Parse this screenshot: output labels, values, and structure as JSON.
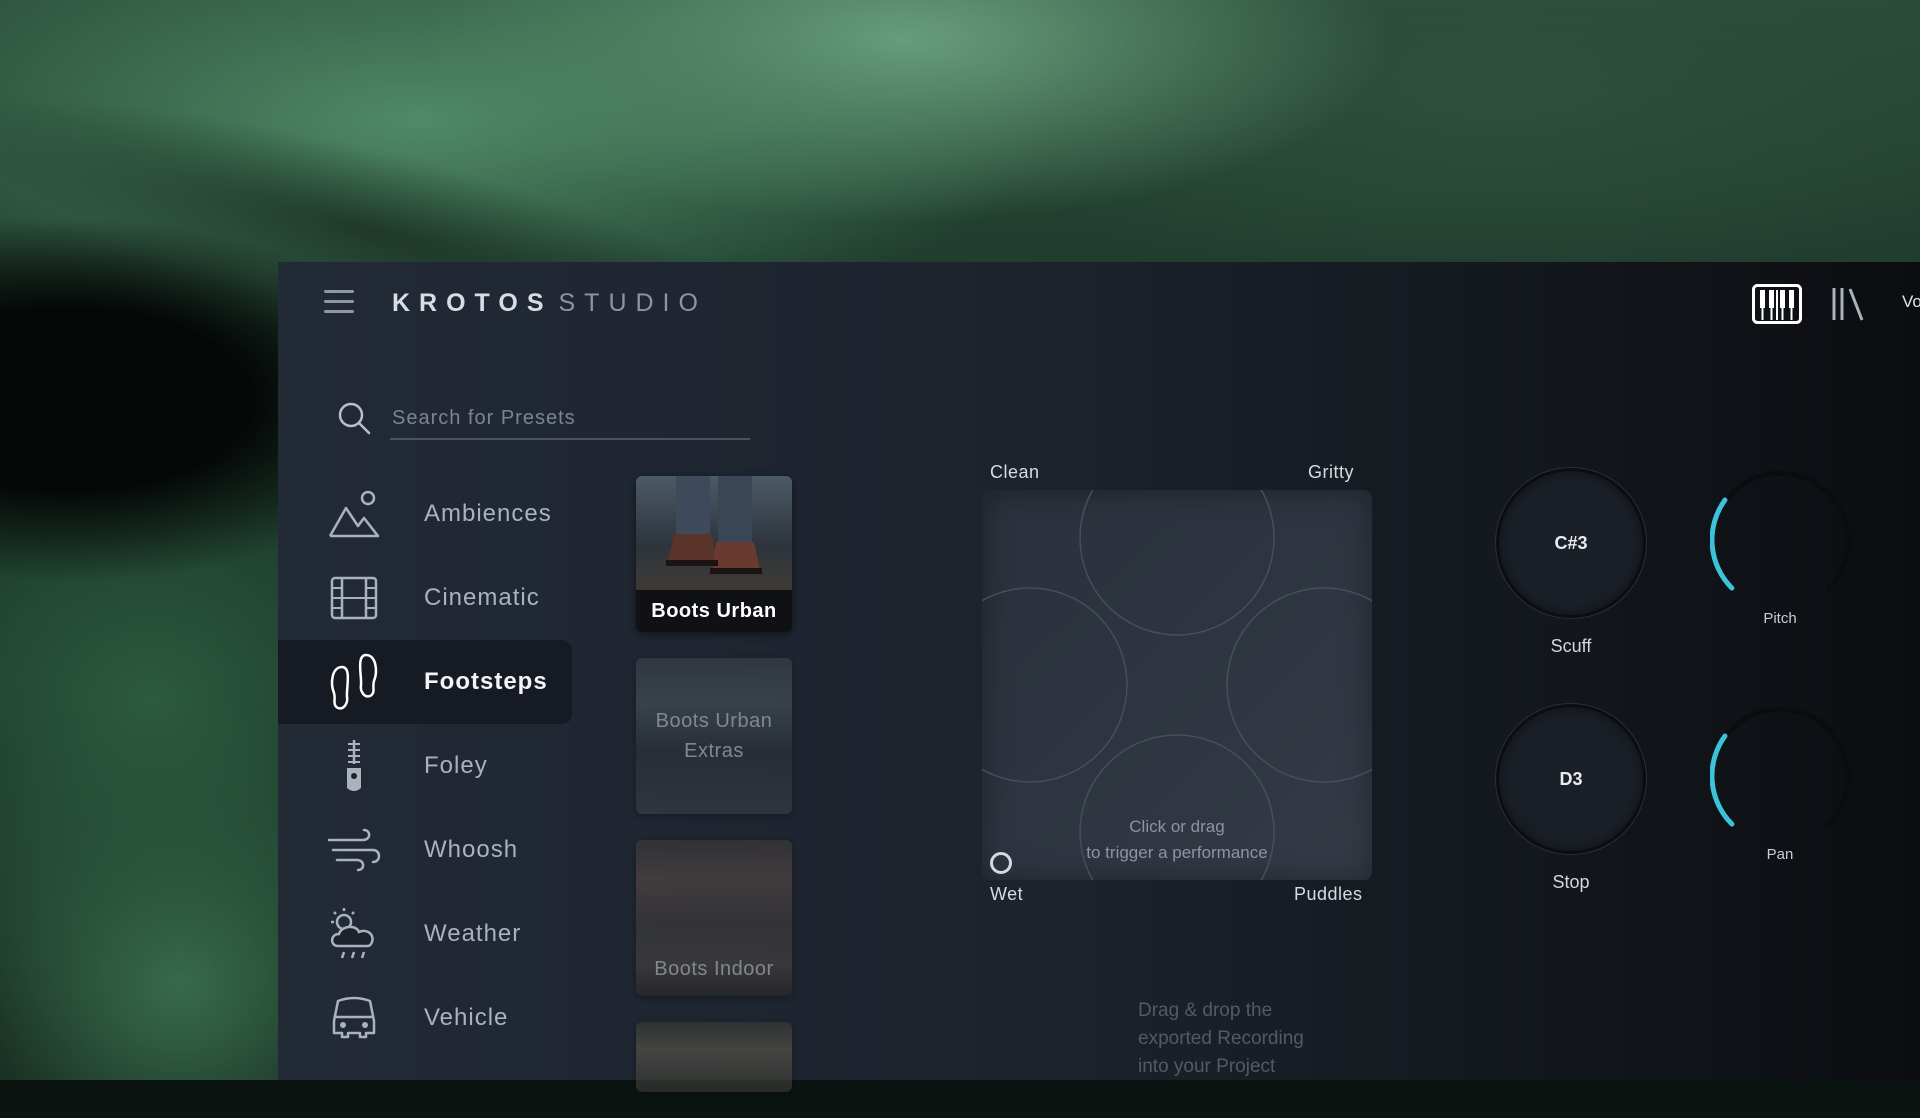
{
  "colors": {
    "accent": "#3dc3d8",
    "panel": "#222a36",
    "active_row": "#161b23"
  },
  "brand": {
    "name_bold": "KROTOS",
    "name_light": "STUDIO"
  },
  "header": {
    "menu_icon": "hamburger-menu-icon",
    "piano_icon": "piano-keys-icon",
    "library_icon": "library-icon",
    "volume_label_partial": "Vo"
  },
  "search": {
    "placeholder": "Search for Presets",
    "value": ""
  },
  "sidebar": {
    "items": [
      {
        "label": "Ambiences",
        "icon": "mountain-sun-icon",
        "active": false
      },
      {
        "label": "Cinematic",
        "icon": "film-strip-icon",
        "active": false
      },
      {
        "label": "Footsteps",
        "icon": "footprints-icon",
        "active": true
      },
      {
        "label": "Foley",
        "icon": "zipper-icon",
        "active": false
      },
      {
        "label": "Whoosh",
        "icon": "wind-icon",
        "active": false
      },
      {
        "label": "Weather",
        "icon": "sun-cloud-rain-icon",
        "active": false
      },
      {
        "label": "Vehicle",
        "icon": "car-icon",
        "active": false
      }
    ]
  },
  "presets": [
    {
      "label": "Boots Urban",
      "selected": true
    },
    {
      "label": "Boots Urban Extras",
      "selected": false
    },
    {
      "label": "Boots Indoor",
      "selected": false
    },
    {
      "label": "",
      "selected": false
    }
  ],
  "pad": {
    "top_left": "Clean",
    "top_right": "Gritty",
    "bottom_left": "Wet",
    "bottom_right": "Puddles",
    "hint_line1": "Click or drag",
    "hint_line2": "to trigger a performance"
  },
  "knobs": {
    "scuff": {
      "note": "C#3",
      "label": "Scuff"
    },
    "stop": {
      "note": "D3",
      "label": "Stop"
    },
    "pitch": {
      "label": "Pitch",
      "value": 0.3
    },
    "pan": {
      "label": "Pan",
      "value": 0.3
    }
  },
  "dropnote": {
    "line1": "Drag & drop the",
    "line2": "exported Recording",
    "line3": "into your Project"
  }
}
